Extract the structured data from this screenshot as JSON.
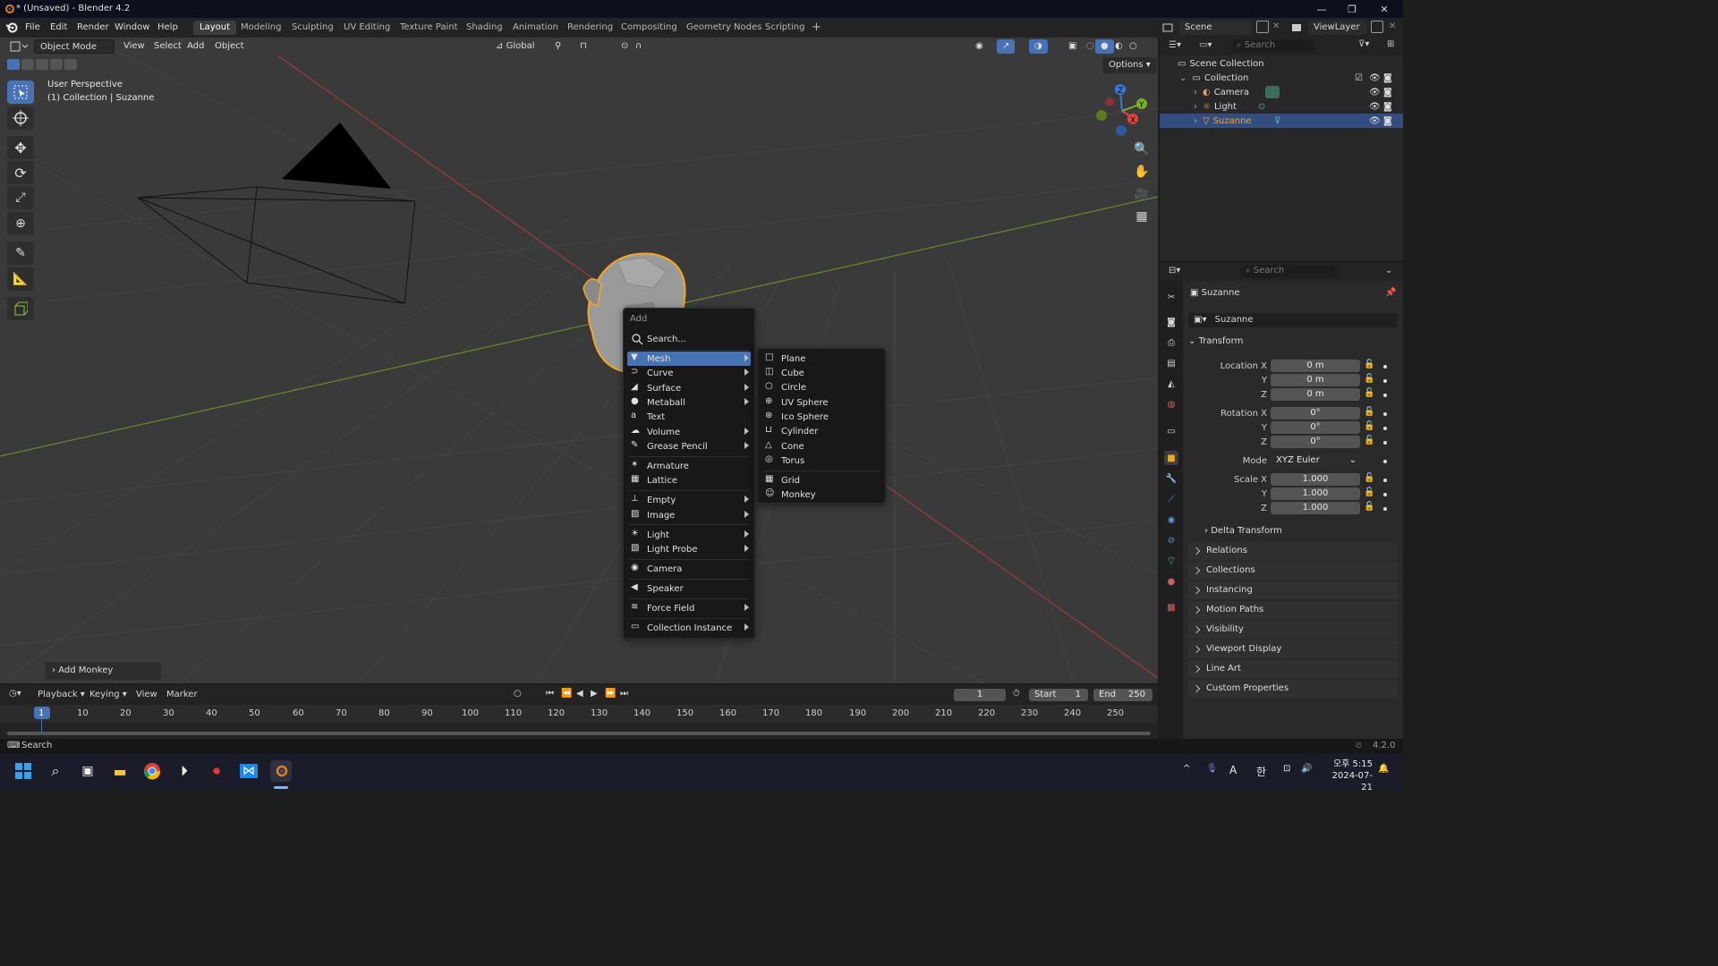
{
  "window": {
    "title": "* (Unsaved) - Blender 4.2"
  },
  "menubar": [
    "File",
    "Edit",
    "Render",
    "Window",
    "Help"
  ],
  "workspaces": [
    {
      "label": "Layout",
      "active": true
    },
    {
      "label": "Modeling"
    },
    {
      "label": "Sculpting"
    },
    {
      "label": "UV Editing"
    },
    {
      "label": "Texture Paint"
    },
    {
      "label": "Shading"
    },
    {
      "label": "Animation"
    },
    {
      "label": "Rendering"
    },
    {
      "label": "Compositing"
    },
    {
      "label": "Geometry Nodes"
    },
    {
      "label": "Scripting"
    }
  ],
  "scene": {
    "name": "Scene",
    "view_layer": "ViewLayer"
  },
  "viewport": {
    "mode": "Object Mode",
    "menus": [
      "View",
      "Select",
      "Add",
      "Object"
    ],
    "transform_orientation": "Global",
    "options_label": "Options",
    "overlay_line1": "User Perspective",
    "overlay_line2": "(1) Collection | Suzanne",
    "last_op": "Add Monkey"
  },
  "add_menu": {
    "title": "Add",
    "search": "Search...",
    "items": [
      "Mesh",
      "Curve",
      "Surface",
      "Metaball",
      "Text",
      "Volume",
      "Grease Pencil",
      "Armature",
      "Lattice",
      "Empty",
      "Image",
      "Light",
      "Light Probe",
      "Camera",
      "Speaker",
      "Force Field",
      "Collection Instance"
    ]
  },
  "mesh_menu": {
    "items": [
      "Plane",
      "Cube",
      "Circle",
      "UV Sphere",
      "Ico Sphere",
      "Cylinder",
      "Cone",
      "Torus",
      "Grid",
      "Monkey"
    ]
  },
  "outliner": {
    "search_placeholder": "Search",
    "root": "Scene Collection",
    "collection": "Collection",
    "objects": [
      "Camera",
      "Light",
      "Suzanne"
    ],
    "selected": "Suzanne"
  },
  "properties": {
    "search_placeholder": "Search",
    "object_name": "Suzanne",
    "datablock": "Suzanne",
    "transform_label": "Transform",
    "location_label": "Location X",
    "rotation_label": "Rotation X",
    "scale_label": "Scale X",
    "axis_y": "Y",
    "axis_z": "Z",
    "location": [
      "0 m",
      "0 m",
      "0 m"
    ],
    "rotation": [
      "0°",
      "0°",
      "0°"
    ],
    "mode_label": "Mode",
    "mode_value": "XYZ Euler",
    "scale": [
      "1.000",
      "1.000",
      "1.000"
    ],
    "delta_transform": "Delta Transform",
    "panels": [
      "Relations",
      "Collections",
      "Instancing",
      "Motion Paths",
      "Visibility",
      "Viewport Display",
      "Line Art",
      "Custom Properties"
    ]
  },
  "timeline": {
    "menus": [
      "Playback",
      "Keying",
      "View",
      "Marker"
    ],
    "current_frame": "1",
    "start_label": "Start",
    "start": "1",
    "end_label": "End",
    "end": "250",
    "ticks": [
      "1",
      "10",
      "20",
      "30",
      "40",
      "50",
      "60",
      "70",
      "80",
      "90",
      "100",
      "110",
      "120",
      "130",
      "140",
      "150",
      "160",
      "170",
      "180",
      "190",
      "200",
      "210",
      "220",
      "230",
      "240",
      "250"
    ]
  },
  "statusbar": {
    "search": "Search",
    "version": "4.2.0"
  },
  "taskbar": {
    "time": "오후 5:15",
    "date": "2024-07-21",
    "ime": "A",
    "lang": "한"
  },
  "colors": {
    "accent": "#4772b3",
    "selected_outline": "#f5a623",
    "menu_bg": "#181818"
  }
}
